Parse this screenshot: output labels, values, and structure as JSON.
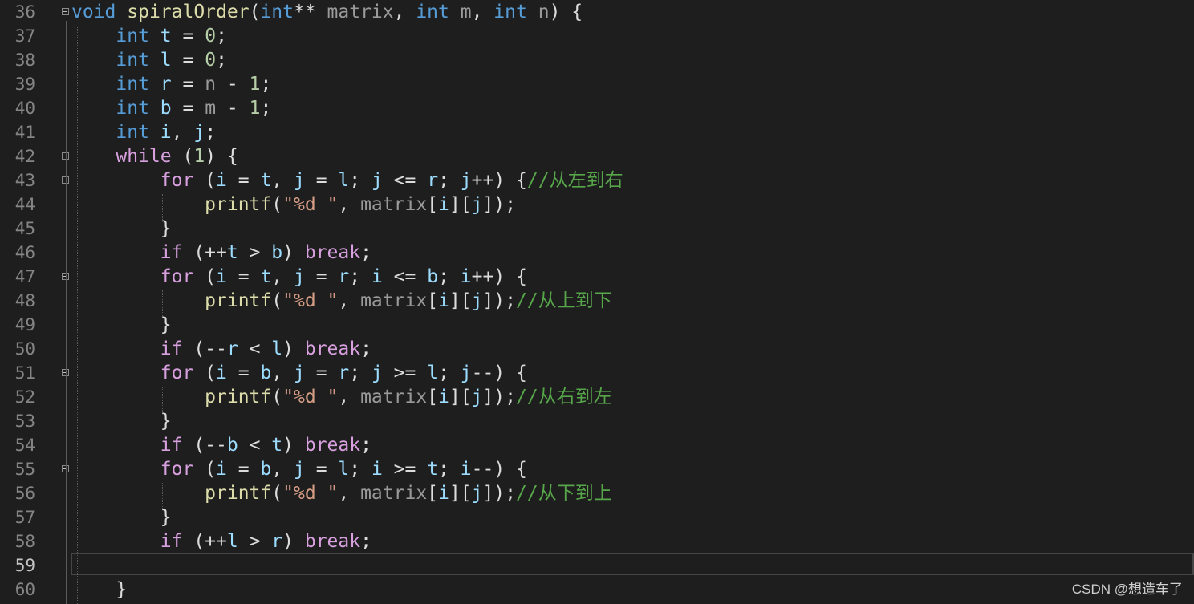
{
  "editor": {
    "current_line": "59",
    "lines": [
      {
        "num": "36",
        "foldable": true,
        "tokens": [
          {
            "t": "void",
            "c": "k"
          },
          {
            "t": " "
          },
          {
            "t": "spiralOrder",
            "c": "fn"
          },
          {
            "t": "("
          },
          {
            "t": "int",
            "c": "k"
          },
          {
            "t": "** "
          },
          {
            "t": "matrix",
            "c": "p"
          },
          {
            "t": ", "
          },
          {
            "t": "int",
            "c": "k"
          },
          {
            "t": " "
          },
          {
            "t": "m",
            "c": "p"
          },
          {
            "t": ", "
          },
          {
            "t": "int",
            "c": "k"
          },
          {
            "t": " "
          },
          {
            "t": "n",
            "c": "p"
          },
          {
            "t": ") {"
          }
        ]
      },
      {
        "num": "37",
        "tokens": [
          {
            "t": "    "
          },
          {
            "t": "int",
            "c": "k"
          },
          {
            "t": " "
          },
          {
            "t": "t",
            "c": "v"
          },
          {
            "t": " = "
          },
          {
            "t": "0",
            "c": "n"
          },
          {
            "t": ";"
          }
        ]
      },
      {
        "num": "38",
        "tokens": [
          {
            "t": "    "
          },
          {
            "t": "int",
            "c": "k"
          },
          {
            "t": " "
          },
          {
            "t": "l",
            "c": "v"
          },
          {
            "t": " = "
          },
          {
            "t": "0",
            "c": "n"
          },
          {
            "t": ";"
          }
        ]
      },
      {
        "num": "39",
        "tokens": [
          {
            "t": "    "
          },
          {
            "t": "int",
            "c": "k"
          },
          {
            "t": " "
          },
          {
            "t": "r",
            "c": "v"
          },
          {
            "t": " = "
          },
          {
            "t": "n",
            "c": "p"
          },
          {
            "t": " - "
          },
          {
            "t": "1",
            "c": "n"
          },
          {
            "t": ";"
          }
        ]
      },
      {
        "num": "40",
        "tokens": [
          {
            "t": "    "
          },
          {
            "t": "int",
            "c": "k"
          },
          {
            "t": " "
          },
          {
            "t": "b",
            "c": "v"
          },
          {
            "t": " = "
          },
          {
            "t": "m",
            "c": "p"
          },
          {
            "t": " - "
          },
          {
            "t": "1",
            "c": "n"
          },
          {
            "t": ";"
          }
        ]
      },
      {
        "num": "41",
        "tokens": [
          {
            "t": "    "
          },
          {
            "t": "int",
            "c": "k"
          },
          {
            "t": " "
          },
          {
            "t": "i",
            "c": "v"
          },
          {
            "t": ", "
          },
          {
            "t": "j",
            "c": "v"
          },
          {
            "t": ";"
          }
        ]
      },
      {
        "num": "42",
        "foldable": true,
        "tokens": [
          {
            "t": "    "
          },
          {
            "t": "while",
            "c": "ctl"
          },
          {
            "t": " ("
          },
          {
            "t": "1",
            "c": "n"
          },
          {
            "t": ") {"
          }
        ]
      },
      {
        "num": "43",
        "foldable": true,
        "tokens": [
          {
            "t": "        "
          },
          {
            "t": "for",
            "c": "ctl"
          },
          {
            "t": " ("
          },
          {
            "t": "i",
            "c": "v"
          },
          {
            "t": " = "
          },
          {
            "t": "t",
            "c": "v"
          },
          {
            "t": ", "
          },
          {
            "t": "j",
            "c": "v"
          },
          {
            "t": " = "
          },
          {
            "t": "l",
            "c": "v"
          },
          {
            "t": "; "
          },
          {
            "t": "j",
            "c": "v"
          },
          {
            "t": " <= "
          },
          {
            "t": "r",
            "c": "v"
          },
          {
            "t": "; "
          },
          {
            "t": "j",
            "c": "v"
          },
          {
            "t": "++) {"
          },
          {
            "t": "//从左到右",
            "c": "c"
          }
        ]
      },
      {
        "num": "44",
        "tokens": [
          {
            "t": "            "
          },
          {
            "t": "printf",
            "c": "fn"
          },
          {
            "t": "("
          },
          {
            "t": "\"%d \"",
            "c": "s"
          },
          {
            "t": ", "
          },
          {
            "t": "matrix",
            "c": "p"
          },
          {
            "t": "["
          },
          {
            "t": "i",
            "c": "v"
          },
          {
            "t": "]["
          },
          {
            "t": "j",
            "c": "v"
          },
          {
            "t": "]);"
          }
        ]
      },
      {
        "num": "45",
        "tokens": [
          {
            "t": "        }"
          }
        ]
      },
      {
        "num": "46",
        "tokens": [
          {
            "t": "        "
          },
          {
            "t": "if",
            "c": "ctl"
          },
          {
            "t": " (++"
          },
          {
            "t": "t",
            "c": "v"
          },
          {
            "t": " > "
          },
          {
            "t": "b",
            "c": "v"
          },
          {
            "t": ") "
          },
          {
            "t": "break",
            "c": "ctl"
          },
          {
            "t": ";"
          }
        ]
      },
      {
        "num": "47",
        "foldable": true,
        "tokens": [
          {
            "t": "        "
          },
          {
            "t": "for",
            "c": "ctl"
          },
          {
            "t": " ("
          },
          {
            "t": "i",
            "c": "v"
          },
          {
            "t": " = "
          },
          {
            "t": "t",
            "c": "v"
          },
          {
            "t": ", "
          },
          {
            "t": "j",
            "c": "v"
          },
          {
            "t": " = "
          },
          {
            "t": "r",
            "c": "v"
          },
          {
            "t": "; "
          },
          {
            "t": "i",
            "c": "v"
          },
          {
            "t": " <= "
          },
          {
            "t": "b",
            "c": "v"
          },
          {
            "t": "; "
          },
          {
            "t": "i",
            "c": "v"
          },
          {
            "t": "++) {"
          }
        ]
      },
      {
        "num": "48",
        "tokens": [
          {
            "t": "            "
          },
          {
            "t": "printf",
            "c": "fn"
          },
          {
            "t": "("
          },
          {
            "t": "\"%d \"",
            "c": "s"
          },
          {
            "t": ", "
          },
          {
            "t": "matrix",
            "c": "p"
          },
          {
            "t": "["
          },
          {
            "t": "i",
            "c": "v"
          },
          {
            "t": "]["
          },
          {
            "t": "j",
            "c": "v"
          },
          {
            "t": "]);"
          },
          {
            "t": "//从上到下",
            "c": "c"
          }
        ]
      },
      {
        "num": "49",
        "tokens": [
          {
            "t": "        }"
          }
        ]
      },
      {
        "num": "50",
        "tokens": [
          {
            "t": "        "
          },
          {
            "t": "if",
            "c": "ctl"
          },
          {
            "t": " (--"
          },
          {
            "t": "r",
            "c": "v"
          },
          {
            "t": " < "
          },
          {
            "t": "l",
            "c": "v"
          },
          {
            "t": ") "
          },
          {
            "t": "break",
            "c": "ctl"
          },
          {
            "t": ";"
          }
        ]
      },
      {
        "num": "51",
        "foldable": true,
        "tokens": [
          {
            "t": "        "
          },
          {
            "t": "for",
            "c": "ctl"
          },
          {
            "t": " ("
          },
          {
            "t": "i",
            "c": "v"
          },
          {
            "t": " = "
          },
          {
            "t": "b",
            "c": "v"
          },
          {
            "t": ", "
          },
          {
            "t": "j",
            "c": "v"
          },
          {
            "t": " = "
          },
          {
            "t": "r",
            "c": "v"
          },
          {
            "t": "; "
          },
          {
            "t": "j",
            "c": "v"
          },
          {
            "t": " >= "
          },
          {
            "t": "l",
            "c": "v"
          },
          {
            "t": "; "
          },
          {
            "t": "j",
            "c": "v"
          },
          {
            "t": "--) {"
          }
        ]
      },
      {
        "num": "52",
        "tokens": [
          {
            "t": "            "
          },
          {
            "t": "printf",
            "c": "fn"
          },
          {
            "t": "("
          },
          {
            "t": "\"%d \"",
            "c": "s"
          },
          {
            "t": ", "
          },
          {
            "t": "matrix",
            "c": "p"
          },
          {
            "t": "["
          },
          {
            "t": "i",
            "c": "v"
          },
          {
            "t": "]["
          },
          {
            "t": "j",
            "c": "v"
          },
          {
            "t": "]);"
          },
          {
            "t": "//从右到左",
            "c": "c"
          }
        ]
      },
      {
        "num": "53",
        "tokens": [
          {
            "t": "        }"
          }
        ]
      },
      {
        "num": "54",
        "tokens": [
          {
            "t": "        "
          },
          {
            "t": "if",
            "c": "ctl"
          },
          {
            "t": " (--"
          },
          {
            "t": "b",
            "c": "v"
          },
          {
            "t": " < "
          },
          {
            "t": "t",
            "c": "v"
          },
          {
            "t": ") "
          },
          {
            "t": "break",
            "c": "ctl"
          },
          {
            "t": ";"
          }
        ]
      },
      {
        "num": "55",
        "foldable": true,
        "tokens": [
          {
            "t": "        "
          },
          {
            "t": "for",
            "c": "ctl"
          },
          {
            "t": " ("
          },
          {
            "t": "i",
            "c": "v"
          },
          {
            "t": " = "
          },
          {
            "t": "b",
            "c": "v"
          },
          {
            "t": ", "
          },
          {
            "t": "j",
            "c": "v"
          },
          {
            "t": " = "
          },
          {
            "t": "l",
            "c": "v"
          },
          {
            "t": "; "
          },
          {
            "t": "i",
            "c": "v"
          },
          {
            "t": " >= "
          },
          {
            "t": "t",
            "c": "v"
          },
          {
            "t": "; "
          },
          {
            "t": "i",
            "c": "v"
          },
          {
            "t": "--) {"
          }
        ]
      },
      {
        "num": "56",
        "tokens": [
          {
            "t": "            "
          },
          {
            "t": "printf",
            "c": "fn"
          },
          {
            "t": "("
          },
          {
            "t": "\"%d \"",
            "c": "s"
          },
          {
            "t": ", "
          },
          {
            "t": "matrix",
            "c": "p"
          },
          {
            "t": "["
          },
          {
            "t": "i",
            "c": "v"
          },
          {
            "t": "]["
          },
          {
            "t": "j",
            "c": "v"
          },
          {
            "t": "]);"
          },
          {
            "t": "//从下到上",
            "c": "c"
          }
        ]
      },
      {
        "num": "57",
        "tokens": [
          {
            "t": "        }"
          }
        ]
      },
      {
        "num": "58",
        "tokens": [
          {
            "t": "        "
          },
          {
            "t": "if",
            "c": "ctl"
          },
          {
            "t": " (++"
          },
          {
            "t": "l",
            "c": "v"
          },
          {
            "t": " > "
          },
          {
            "t": "r",
            "c": "v"
          },
          {
            "t": ") "
          },
          {
            "t": "break",
            "c": "ctl"
          },
          {
            "t": ";"
          }
        ]
      },
      {
        "num": "59",
        "tokens": []
      },
      {
        "num": "60",
        "tokens": [
          {
            "t": "    }"
          }
        ]
      }
    ]
  },
  "watermark": "CSDN @想造车了"
}
